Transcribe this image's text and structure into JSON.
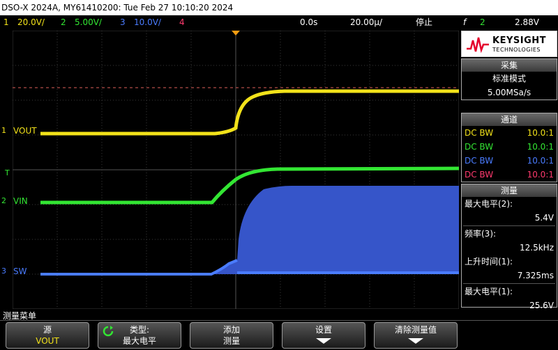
{
  "title": "DSO-X 2024A, MY61410200: Tue Feb 27 10:10:20 2024",
  "status": {
    "ch1": {
      "num": "1",
      "scale": "20.0V/",
      "color": "#f2e21a"
    },
    "ch2": {
      "num": "2",
      "scale": "5.00V/",
      "color": "#33e633"
    },
    "ch3": {
      "num": "3",
      "scale": "10.0V/",
      "color": "#4a7cff"
    },
    "ch4": {
      "num": "4",
      "color": "#ff3a6e"
    },
    "delay": "0.0s",
    "timebase": "20.00µ/",
    "run_state": "停止",
    "trigger_symbol": "f",
    "trigger_channel": "2",
    "trigger_level": "2.88V"
  },
  "trace_labels": {
    "ch1": {
      "num": "1",
      "name": "VOUT"
    },
    "ch2": {
      "num": "2",
      "name": "VIN"
    },
    "ch3": {
      "num": "3",
      "name": "SW"
    },
    "trigger_marker": "T"
  },
  "logo": {
    "brand": "KEYSIGHT",
    "sub": "TECHNOLOGIES"
  },
  "acquire": {
    "header": "采集",
    "mode": "标准模式",
    "rate": "5.00MSa/s"
  },
  "channels": {
    "header": "通道",
    "rows": [
      {
        "coupling": "DC BW",
        "probe": "10.0:1",
        "color": "#f2e21a"
      },
      {
        "coupling": "DC BW",
        "probe": "10.0:1",
        "color": "#33e633"
      },
      {
        "coupling": "DC BW",
        "probe": "10.0:1",
        "color": "#4a7cff"
      },
      {
        "coupling": "DC BW",
        "probe": "10.0:1",
        "color": "#ff3a6e"
      }
    ]
  },
  "measure": {
    "header": "测量",
    "items": [
      {
        "label": "最大电平(2):",
        "value": "5.4V"
      },
      {
        "label": "频率(3):",
        "value": "12.5kHz"
      },
      {
        "label": "上升时间(1):",
        "value": "7.325ms"
      },
      {
        "label": "最大电平(1):",
        "value": "25.6V"
      }
    ]
  },
  "menu_title": "测量菜单",
  "softkeys": [
    {
      "line1": "源",
      "line2": "VOUT"
    },
    {
      "line1": "类型:",
      "line2": "最大电平"
    },
    {
      "line1": "添加",
      "line2": "测量"
    },
    {
      "line1": "设置",
      "line2": ""
    },
    {
      "line1": "清除测量值",
      "line2": ""
    }
  ]
}
